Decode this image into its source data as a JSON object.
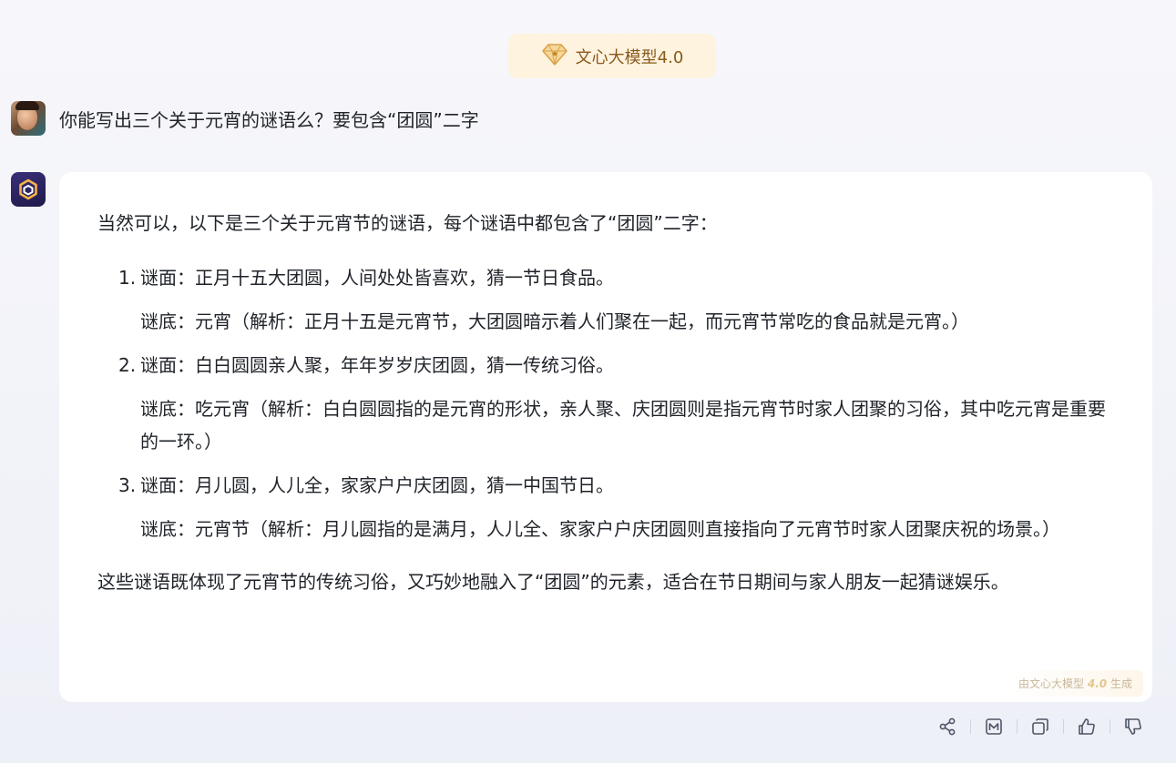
{
  "model_badge": {
    "label": "文心大模型4.0",
    "icon": "diamond-icon",
    "accent": "#d9a14a"
  },
  "user_message": {
    "text": "你能写出三个关于元宵的谜语么？要包含“团圆”二字"
  },
  "answer": {
    "intro": "当然可以，以下是三个关于元宵节的谜语，每个谜语中都包含了“团圆”二字：",
    "riddles": [
      {
        "number": "1.",
        "question": "谜面：正月十五大团圆，人间处处皆喜欢，猜一节日食品。",
        "answer": "谜底：元宵（解析：正月十五是元宵节，大团圆暗示着人们聚在一起，而元宵节常吃的食品就是元宵。）"
      },
      {
        "number": "2.",
        "question": "谜面：白白圆圆亲人聚，年年岁岁庆团圆，猜一传统习俗。",
        "answer": "谜底：吃元宵（解析：白白圆圆指的是元宵的形状，亲人聚、庆团圆则是指元宵节时家人团聚的习俗，其中吃元宵是重要的一环。）"
      },
      {
        "number": "3.",
        "question": "谜面：月儿圆，人儿全，家家户户庆团圆，猜一中国节日。",
        "answer": "谜底：元宵节（解析：月儿圆指的是满月，人儿全、家家户户庆团圆则直接指向了元宵节时家人团聚庆祝的场景。）"
      }
    ],
    "outro": "这些谜语既体现了元宵节的传统习俗，又巧妙地融入了“团圆”的元素，适合在节日期间与家人朋友一起猜谜娱乐。",
    "generated_by_prefix": "由文心大模型",
    "generated_by_version": "4.0",
    "generated_by_suffix": "生成"
  },
  "actions": [
    {
      "name": "share",
      "icon": "share-icon"
    },
    {
      "name": "mindmap",
      "icon": "chart-icon"
    },
    {
      "name": "copy",
      "icon": "copy-icon"
    },
    {
      "name": "like",
      "icon": "thumbs-up-icon"
    },
    {
      "name": "dislike",
      "icon": "thumbs-down-icon"
    }
  ]
}
